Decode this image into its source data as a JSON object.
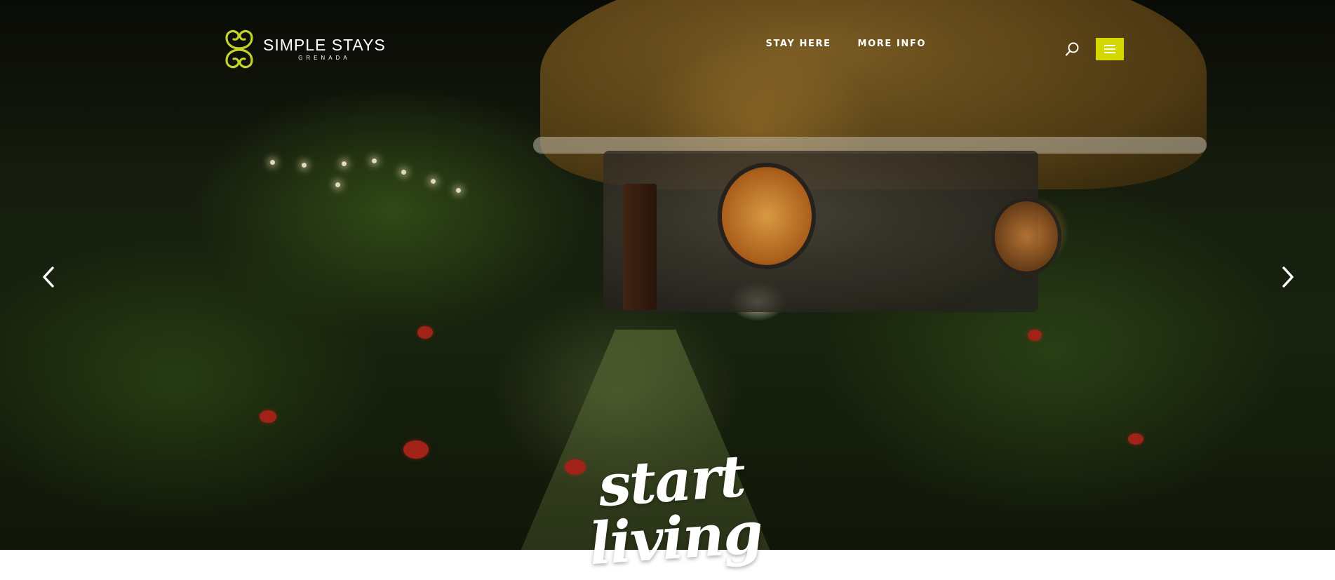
{
  "brand": {
    "name": "SIMPLE STAYS",
    "sub": "GRENADA",
    "logo_icon": "swirl-logo-icon",
    "accent_color": "#c5d22a"
  },
  "nav": {
    "items": [
      {
        "label": "STAY HERE"
      },
      {
        "label": "MORE INFO"
      }
    ],
    "search_icon": "search-icon",
    "menu_icon": "hamburger-menu-icon",
    "menu_button_color": "#d4d800"
  },
  "slider": {
    "prev_icon": "chevron-left-icon",
    "next_icon": "chevron-right-icon",
    "tagline": "start living"
  }
}
